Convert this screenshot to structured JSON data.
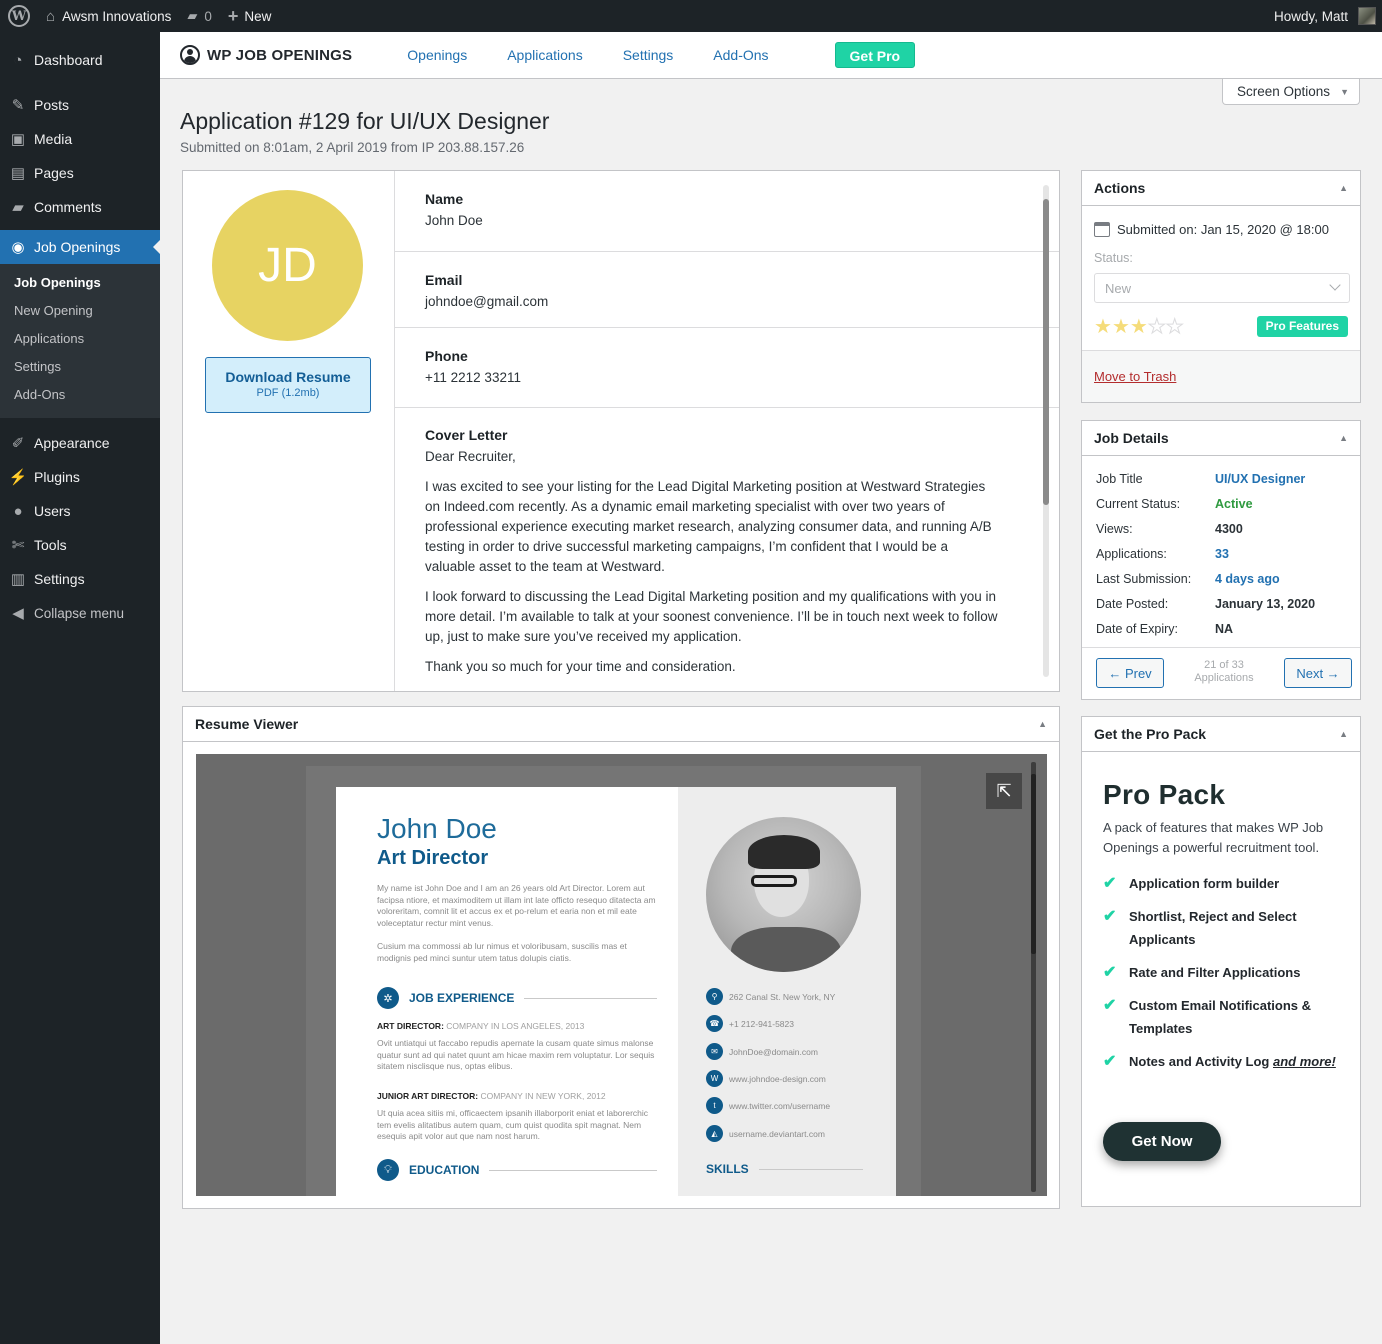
{
  "admin_bar": {
    "site_name": "Awsm Innovations",
    "comments_count": "0",
    "new_label": "New",
    "greeting": "Howdy, Matt",
    "icons": {
      "logo": "wordpress-logo-icon",
      "home": "home-icon",
      "comments": "comment-bubble-icon",
      "new": "plus-icon"
    }
  },
  "sidebar": {
    "items": [
      {
        "label": "Dashboard",
        "icon": "dashboard-icon"
      },
      {
        "label": "Posts",
        "icon": "pin-icon"
      },
      {
        "label": "Media",
        "icon": "media-icon"
      },
      {
        "label": "Pages",
        "icon": "pages-icon"
      },
      {
        "label": "Comments",
        "icon": "comment-icon"
      },
      {
        "label": "Job Openings",
        "icon": "job-openings-icon",
        "active": true
      },
      {
        "label": "Appearance",
        "icon": "paintbrush-icon"
      },
      {
        "label": "Plugins",
        "icon": "plug-icon"
      },
      {
        "label": "Users",
        "icon": "user-icon"
      },
      {
        "label": "Tools",
        "icon": "wrench-icon"
      },
      {
        "label": "Settings",
        "icon": "settings-sliders-icon"
      },
      {
        "label": "Collapse menu",
        "icon": "collapse-arrow-icon"
      }
    ],
    "submenu": [
      "Job Openings",
      "New Opening",
      "Applications",
      "Settings",
      "Add-Ons"
    ]
  },
  "plugin_header": {
    "brand": "WP JOB OPENINGS",
    "nav": [
      "Openings",
      "Applications",
      "Settings",
      "Add-Ons"
    ],
    "get_pro": "Get Pro"
  },
  "screen_options": "Screen Options",
  "page": {
    "title": "Application #129 for UI/UX Designer",
    "subtitle": "Submitted on 8:01am, 2 April 2019 from IP 203.88.157.26"
  },
  "applicant": {
    "initials": "JD",
    "avatar_color": "#e7d362",
    "download_label": "Download Resume",
    "download_meta": "PDF (1.2mb)",
    "fields": [
      {
        "label": "Name",
        "value": "John Doe"
      },
      {
        "label": "Email",
        "value": "johndoe@gmail.com"
      },
      {
        "label": "Phone",
        "value": "+11 2212 33211"
      }
    ],
    "cover_letter": {
      "label": "Cover Letter",
      "paragraphs": [
        "Dear Recruiter,",
        "I was excited to see your listing for the Lead Digital Marketing position at Westward Strategies on Indeed.com recently. As a dynamic email marketing specialist with over two years of professional experience executing market research, analyzing consumer data, and running A/B testing in order to drive successful marketing campaigns, I’m confident that I would be a valuable asset to the team at Westward.",
        "I look forward to discussing the Lead Digital Marketing position and my qualifications with you in more detail. I’m available to talk at your soonest convenience. I’ll be in touch next week to follow up, just to make sure you’ve received my application.",
        "Thank you so much for your time and consideration."
      ]
    }
  },
  "resume_viewer": {
    "title": "Resume Viewer",
    "doc": {
      "name": "John Doe",
      "role": "Art Director",
      "intro1": "My name ist John Doe and I am an 26 years old Art Director. Lorem aut facipsa ntiore, et maximoditem ut illam int late officto resequo ditatecta am voloreritam, comnit lit et accus ex et po-relum et earia non et mil eate voleceptatur rectur mint venus.",
      "intro2": "Cusium ma commossi ab lur nimus et voloribusam, suscilis mas et modignis ped minci suntur utem tatus dolupis ciatis.",
      "section_experience": "JOB EXPERIENCE",
      "jobs": [
        {
          "title": "ART DIRECTOR:",
          "meta": "COMPANY IN LOS ANGELES, 2013",
          "desc": "Ovit untiatqui ut faccabo repudis apernate la cusam quate simus malonse quatur sunt ad qui natet quunt am hicae maxim rem voluptatur. Lor sequis sitatem nisclisque nus, optas elibus."
        },
        {
          "title": "JUNIOR ART DIRECTOR:",
          "meta": "COMPANY IN NEW YORK, 2012",
          "desc": "Ut quia acea sitiis mi, officaectem ipsanih illaborporit eniat et laborerchic tem evelis alitatibus autem quam, cum quist quodita spit magnat. Nem esequis apit volor aut que nam nost harum."
        }
      ],
      "section_education": "EDUCATION",
      "contacts": [
        {
          "icon": "map-pin-icon",
          "glyph": "⚲",
          "text": "262 Canal St. New York, NY"
        },
        {
          "icon": "phone-icon",
          "glyph": "☎",
          "text": "+1 212-941-5823"
        },
        {
          "icon": "mail-icon",
          "glyph": "✉",
          "text": "JohnDoe@domain.com"
        },
        {
          "icon": "web-icon",
          "glyph": "W",
          "text": "www.johndoe-design.com"
        },
        {
          "icon": "twitter-icon",
          "glyph": "t",
          "text": "www.twitter.com/username"
        },
        {
          "icon": "deviantart-icon",
          "glyph": "◭",
          "text": "username.deviantart.com"
        }
      ],
      "section_skills": "SKILLS"
    }
  },
  "actions": {
    "title": "Actions",
    "submitted": "Submitted on: Jan 15, 2020 @ 18:00",
    "status_label": "Status:",
    "status_value": "New",
    "rating": 3,
    "rating_max": 5,
    "pro_features": "Pro Features",
    "trash": "Move to Trash"
  },
  "job_details": {
    "title": "Job Details",
    "rows": [
      {
        "key": "Job Title",
        "value": "UI/UX Designer",
        "style": "link"
      },
      {
        "key": "Current Status:",
        "value": "Active",
        "style": "green"
      },
      {
        "key": "Views:",
        "value": "4300",
        "style": "plain"
      },
      {
        "key": "Applications:",
        "value": "33",
        "style": "link"
      },
      {
        "key": "Last Submission:",
        "value": "4 days ago",
        "style": "link"
      },
      {
        "key": "Date Posted:",
        "value": "January 13, 2020",
        "style": "plain"
      },
      {
        "key": "Date of Expiry:",
        "value": "NA",
        "style": "plain"
      }
    ],
    "prev": "← Prev",
    "next": "Next →",
    "position": "21 of 33",
    "position_label": "Applications"
  },
  "pro_pack": {
    "box_title": "Get the Pro Pack",
    "title": "Pro Pack",
    "description": "A pack of features that makes WP Job Openings a powerful recruitment tool.",
    "features": [
      "Application form builder",
      "Shortlist, Reject and Select Applicants",
      "Rate and Filter Applications",
      "Custom Email Notifications & Templates",
      "Notes and Activity Log"
    ],
    "more": "and more!",
    "cta": "Get Now"
  },
  "colors": {
    "accent": "#2271b1",
    "pro_green": "#1fd3a5",
    "trash_red": "#b32d2e",
    "active_green": "#2e9a3f"
  }
}
